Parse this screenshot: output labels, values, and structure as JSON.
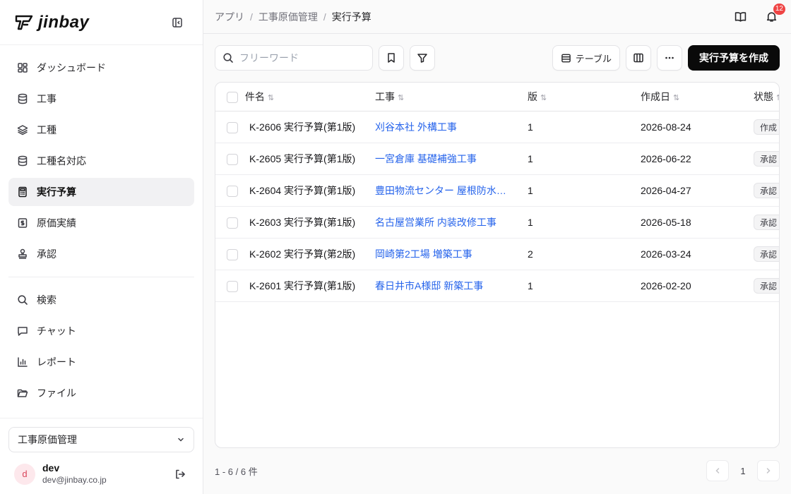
{
  "brand": {
    "name": "jinbay"
  },
  "sidebar": {
    "items": [
      {
        "label": "ダッシュボード",
        "icon": "dashboard-icon"
      },
      {
        "label": "工事",
        "icon": "database-icon"
      },
      {
        "label": "工種",
        "icon": "layers-icon"
      },
      {
        "label": "工種名対応",
        "icon": "database-icon"
      },
      {
        "label": "実行予算",
        "icon": "calculator-icon",
        "active": true
      },
      {
        "label": "原価実績",
        "icon": "receipt-icon"
      },
      {
        "label": "承認",
        "icon": "stamp-icon"
      }
    ],
    "items2": [
      {
        "label": "検索",
        "icon": "search-icon"
      },
      {
        "label": "チャット",
        "icon": "chat-icon"
      },
      {
        "label": "レポート",
        "icon": "bar-chart-icon"
      },
      {
        "label": "ファイル",
        "icon": "folder-icon"
      }
    ],
    "app_select": "工事原価管理",
    "user": {
      "initial": "d",
      "name": "dev",
      "email": "dev@jinbay.co.jp"
    }
  },
  "breadcrumb": [
    "アプリ",
    "工事原価管理",
    "実行予算"
  ],
  "notifications": {
    "count": "12"
  },
  "toolbar": {
    "search_placeholder": "フリーワード",
    "view_label": "テーブル",
    "create_label": "実行予算を作成"
  },
  "table": {
    "columns": [
      "件名",
      "工事",
      "版",
      "作成日",
      "状態"
    ],
    "rows": [
      {
        "name": "K-2606 実行予算(第1版)",
        "project": "刈谷本社 外構工事",
        "version": "1",
        "date": "2026-08-24",
        "status": "作成"
      },
      {
        "name": "K-2605 実行予算(第1版)",
        "project": "一宮倉庫 基礎補強工事",
        "version": "1",
        "date": "2026-06-22",
        "status": "承認"
      },
      {
        "name": "K-2604 実行予算(第1版)",
        "project": "豊田物流センター 屋根防水…",
        "version": "1",
        "date": "2026-04-27",
        "status": "承認"
      },
      {
        "name": "K-2603 実行予算(第1版)",
        "project": "名古屋営業所 内装改修工事",
        "version": "1",
        "date": "2026-05-18",
        "status": "承認"
      },
      {
        "name": "K-2602 実行予算(第2版)",
        "project": "岡崎第2工場 増築工事",
        "version": "2",
        "date": "2026-03-24",
        "status": "承認"
      },
      {
        "name": "K-2601 実行予算(第1版)",
        "project": "春日井市A様邸 新築工事",
        "version": "1",
        "date": "2026-02-20",
        "status": "承認"
      }
    ]
  },
  "footer": {
    "count": "1 - 6 / 6 件",
    "page": "1"
  },
  "colors": {
    "accent": "#0a0a0a",
    "link": "#2563eb",
    "badge": "#ef4444"
  }
}
